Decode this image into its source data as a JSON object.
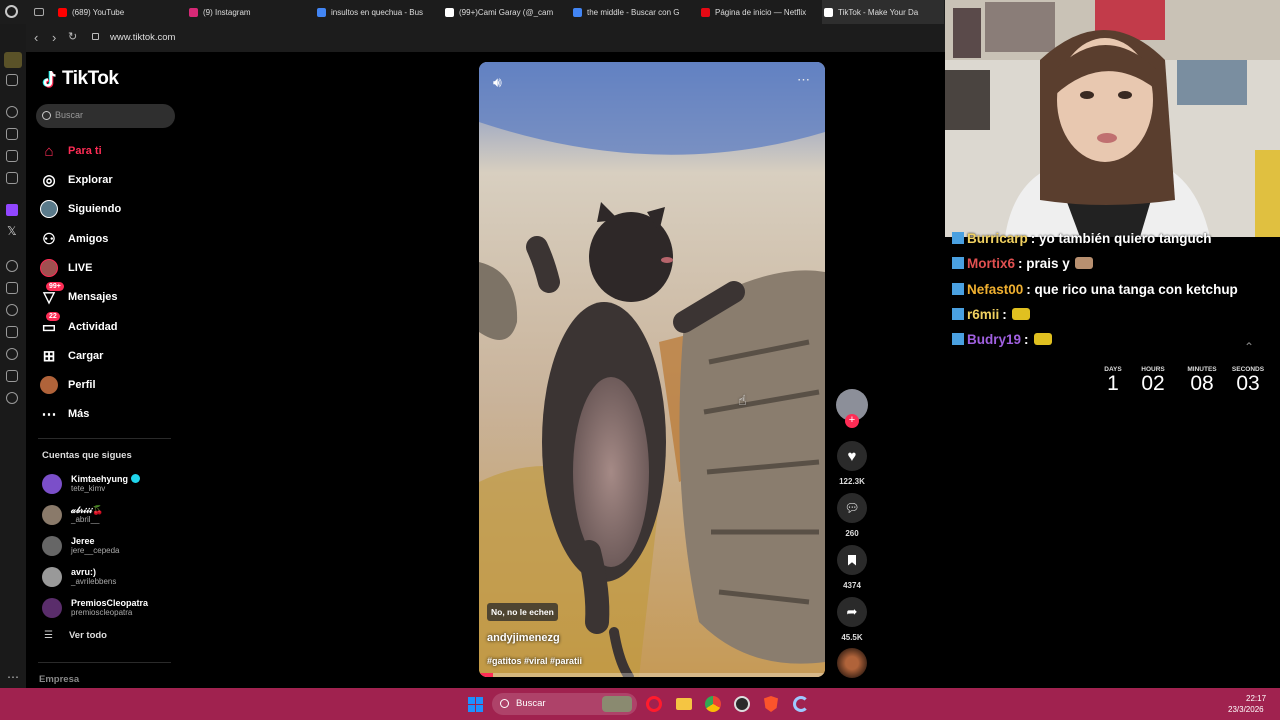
{
  "browser": {
    "tabs": [
      {
        "label": "(689) YouTube",
        "color": "#ff0000"
      },
      {
        "label": "(9) Instagram",
        "color": "#d62976"
      },
      {
        "label": "insultos en quechua - Bus",
        "color": "#4285f4"
      },
      {
        "label": "(99+)Cami Garay (@_cam",
        "color": "#ffffff"
      },
      {
        "label": "the middle - Buscar con G",
        "color": "#4285f4"
      },
      {
        "label": "Página de inicio — Netflix",
        "color": "#e50914"
      },
      {
        "label": "TikTok - Make Your Da",
        "color": "#ffffff"
      }
    ],
    "url": "www.tiktok.com"
  },
  "tiktok": {
    "logo": "TikTok",
    "search_placeholder": "Buscar",
    "nav": [
      {
        "label": "Para ti",
        "icon": "home-icon",
        "active": true
      },
      {
        "label": "Explorar",
        "icon": "compass-icon"
      },
      {
        "label": "Siguiendo",
        "icon": "following-icon"
      },
      {
        "label": "Amigos",
        "icon": "friends-icon"
      },
      {
        "label": "LIVE",
        "icon": "live-icon"
      },
      {
        "label": "Mensajes",
        "icon": "messages-icon",
        "badge": "99+"
      },
      {
        "label": "Actividad",
        "icon": "activity-icon",
        "badge": "22"
      },
      {
        "label": "Cargar",
        "icon": "upload-icon"
      },
      {
        "label": "Perfil",
        "icon": "profile-icon"
      },
      {
        "label": "Más",
        "icon": "more-icon"
      }
    ],
    "following_title": "Cuentas que sigues",
    "following": [
      {
        "name": "Kimtaehyung",
        "handle": "tete_kimv",
        "verified": true,
        "color": "#7b4fc9"
      },
      {
        "name": "𝒶𝒷𝓇𝒾𝒾𝒾🍒",
        "handle": "_abril__",
        "color": "#8a7a6a"
      },
      {
        "name": "Jeree",
        "handle": "jere__cepeda",
        "color": "#666666"
      },
      {
        "name": "avru:)",
        "handle": "_avrilebbens",
        "color": "#999999"
      },
      {
        "name": "PremiosCleopatra",
        "handle": "premioscleopatra",
        "color": "#5a2d6b"
      }
    ],
    "see_all": "Ver todo",
    "company": "Empresa"
  },
  "video": {
    "caption_tag": "No, no le echen",
    "author": "andyjimenezg",
    "hashtags": "#gatitos #viral #paratii",
    "likes": "122.3K",
    "comments": "260",
    "saves": "4374",
    "shares": "45.5K",
    "progress": 0.04
  },
  "taskbar": {
    "search": "Buscar",
    "time": "22:17",
    "date": "23/3/2026"
  },
  "stream": {
    "chat": [
      {
        "user": "Burricarp",
        "text": ": yo también quiero tanguch",
        "color": "#f0d060"
      },
      {
        "user": "Mortix6",
        "text": ": prais y",
        "color": "#e05050"
      },
      {
        "user": "Nefast00",
        "text": ": que rico una tanga con ketchup",
        "color": "#f0b030"
      },
      {
        "user": "r6mii",
        "text": ":",
        "color": "#f0d060"
      },
      {
        "user": "Budry19",
        "text": ":",
        "color": "#a060e0"
      }
    ],
    "countdown": [
      {
        "label": "DAYS",
        "value": "1"
      },
      {
        "label": "HOURS",
        "value": "02"
      },
      {
        "label": "MINUTES",
        "value": "08"
      },
      {
        "label": "SECONDS",
        "value": "03"
      }
    ]
  }
}
